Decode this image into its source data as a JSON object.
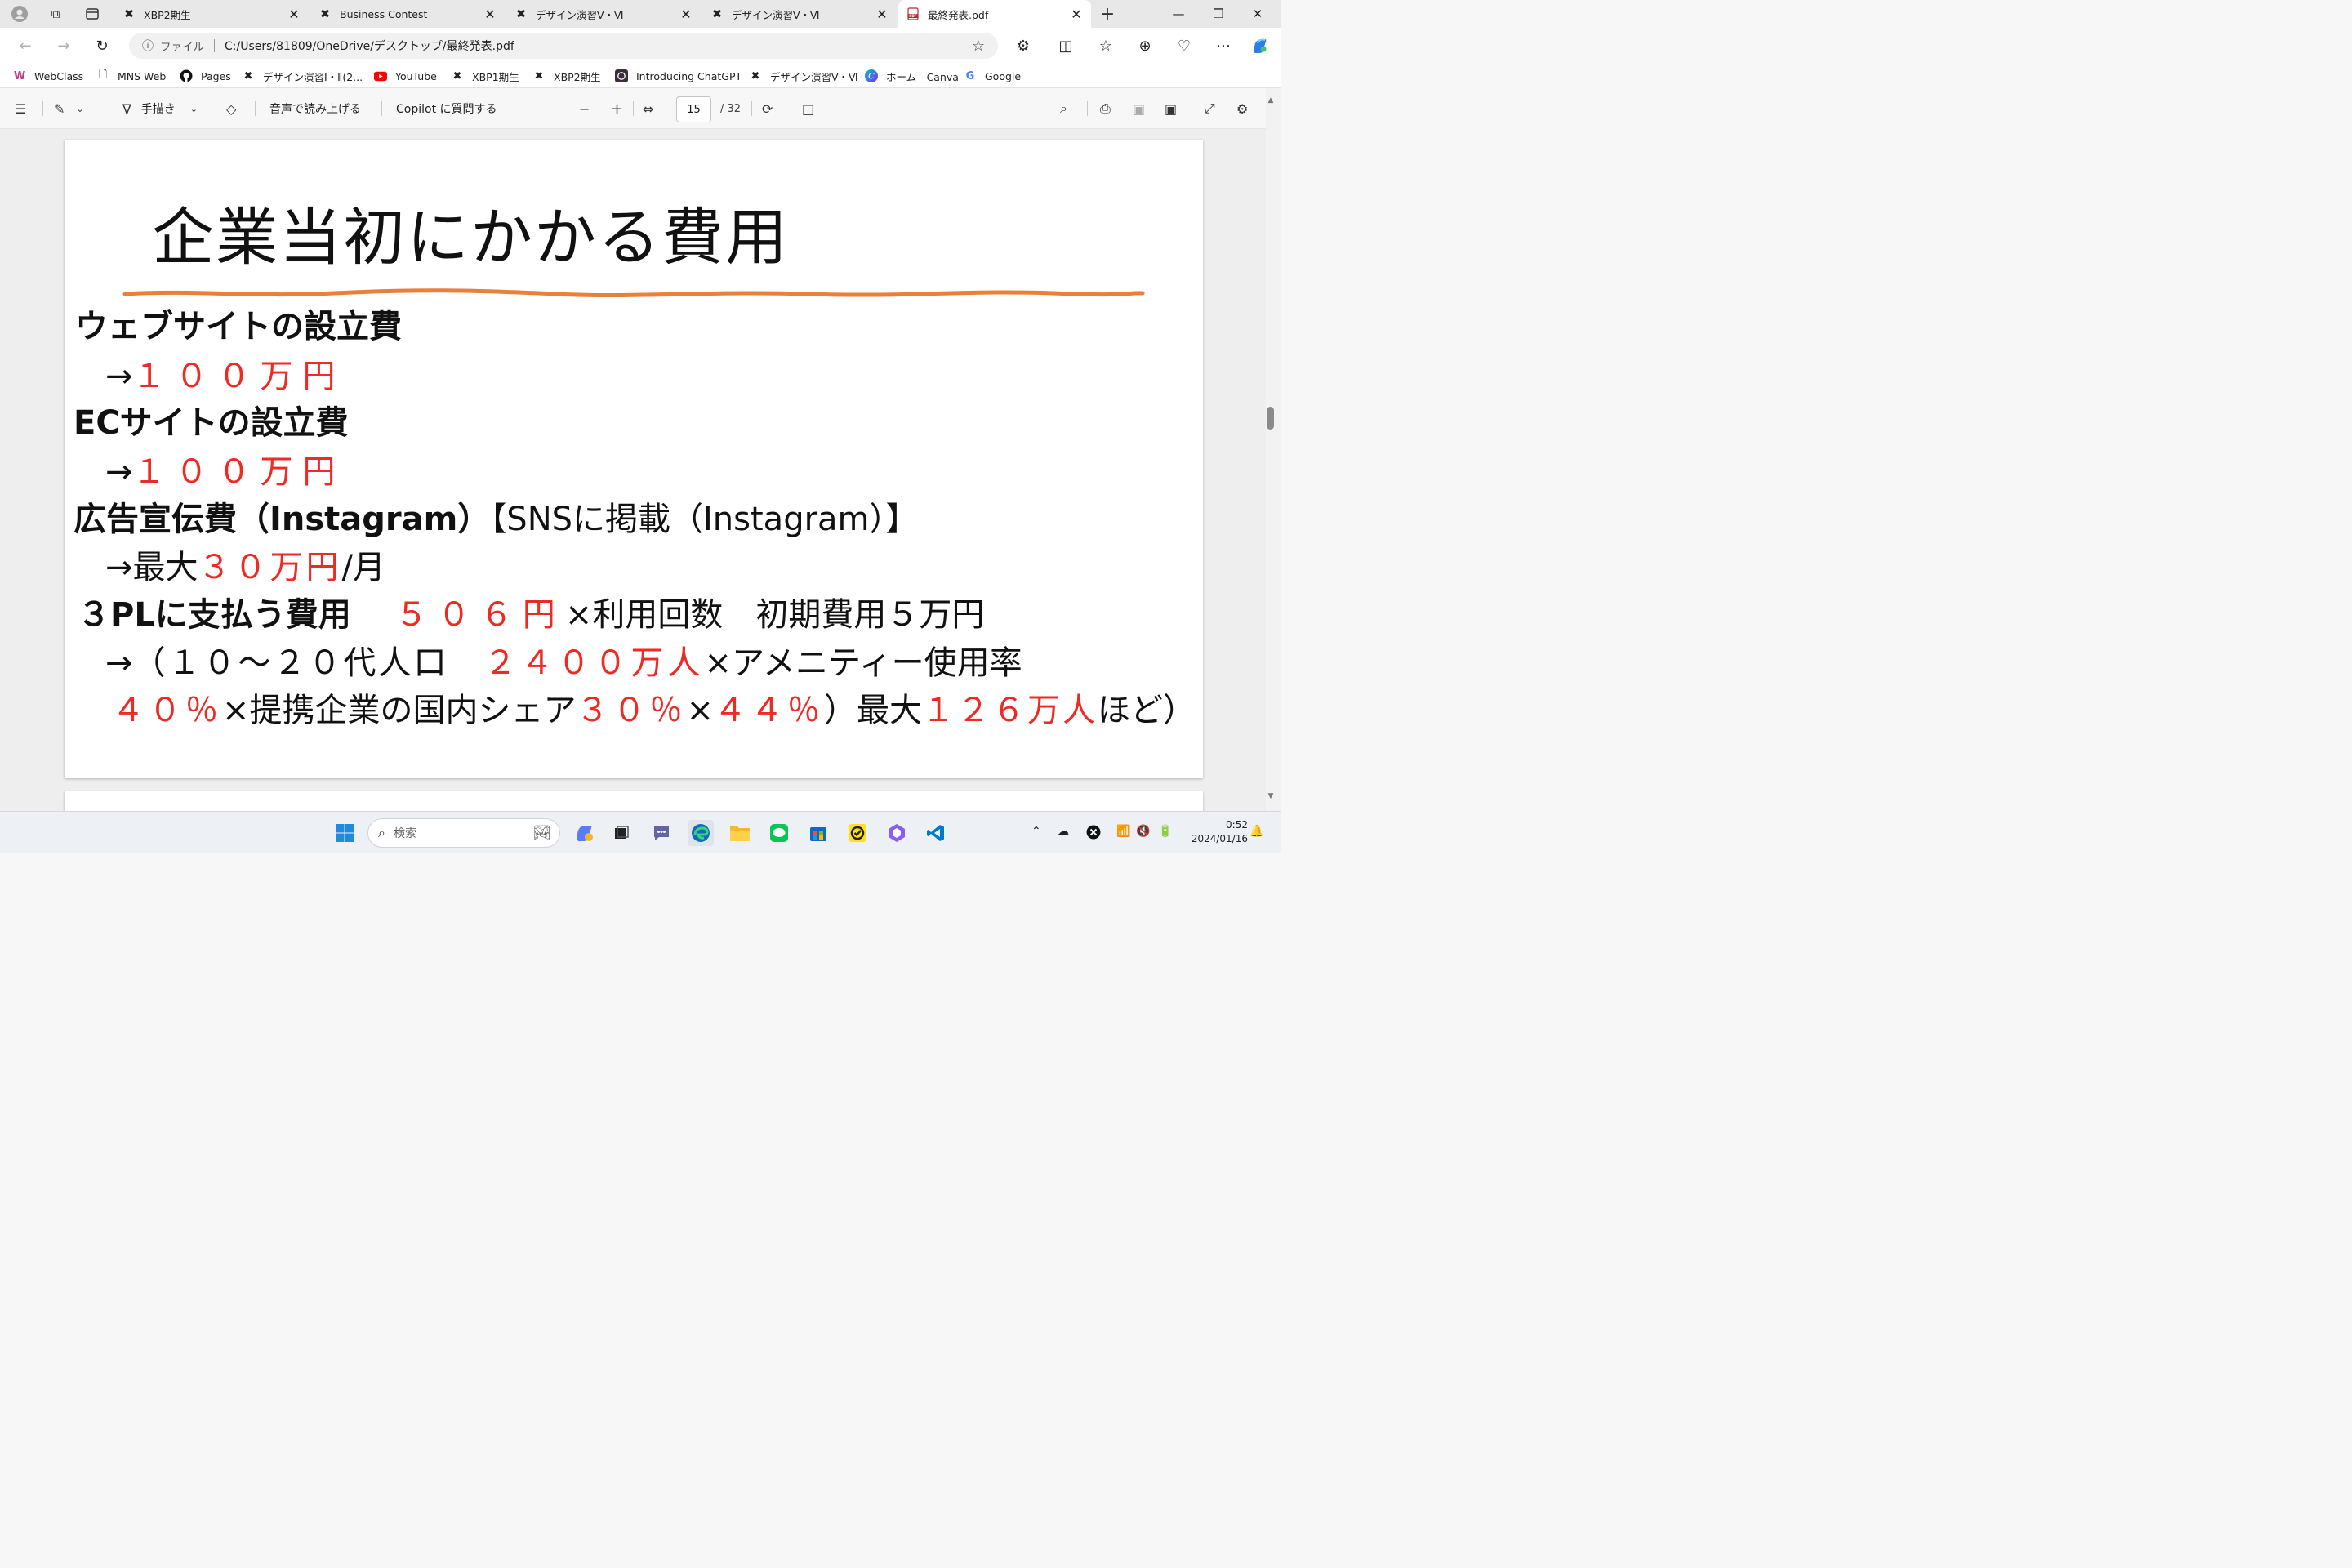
{
  "tabs": [
    {
      "label": "XBP2期生"
    },
    {
      "label": "Business Contest"
    },
    {
      "label": "デザイン演習Ⅴ・Ⅵ"
    },
    {
      "label": "デザイン演習Ⅴ・Ⅵ"
    },
    {
      "label": "最終発表.pdf"
    }
  ],
  "address": {
    "scheme": "ファイル",
    "url": "C:/Users/81809/OneDrive/デスクトップ/最終発表.pdf"
  },
  "favorites": [
    {
      "label": "WebClass"
    },
    {
      "label": "MNS Web"
    },
    {
      "label": "Pages"
    },
    {
      "label": "デザイン演習Ⅰ・Ⅱ(2..."
    },
    {
      "label": "YouTube"
    },
    {
      "label": "XBP1期生"
    },
    {
      "label": "XBP2期生"
    },
    {
      "label": "Introducing ChatGPT"
    },
    {
      "label": "デザイン演習Ⅴ・Ⅵ"
    },
    {
      "label": "ホーム - Canva"
    },
    {
      "label": "Google"
    }
  ],
  "pdf_toolbar": {
    "draw_label": "手描き",
    "read_aloud": "音声で読み上げる",
    "copilot": "Copilot に質問する",
    "page_current": "15",
    "page_total": "/ 32"
  },
  "slide": {
    "title": "企業当初にかかる費用",
    "web_heading": "ウェブサイトの設立費",
    "arrow": "→",
    "web_cost": "１００万円",
    "ec_heading": "ECサイトの設立費",
    "ec_cost": "１００万円",
    "ad_heading": "広告宣伝費（Instagram）",
    "ad_note": "【SNSに掲載（Instagram）】",
    "ad_prefix": "最大",
    "ad_cost": "３０万円",
    "ad_suffix": "/月",
    "pl_heading": "３PLに支払う費用",
    "pl_cost": "５０６円",
    "pl_mid": "×利用回数　初期費用５万円",
    "calc1_prefix": "（１０〜２０代人口　",
    "calc1_red": "２４００万人",
    "calc1_suffix": "×アメニティー使用率",
    "calc2_red1": "４０％",
    "calc2_mid1": "×提携企業の国内シェア",
    "calc2_red2": "３０％",
    "calc2_mid2": "×",
    "calc2_red3": "４４％",
    "calc2_mid3": "）最大",
    "calc2_red4": "１２６万人",
    "calc2_end": "ほど）"
  },
  "taskbar": {
    "search_placeholder": "検索",
    "time": "0:52",
    "date": "2024/01/16"
  },
  "colors": {
    "accent_red": "#ee2a24",
    "underline_orange": "#e8803a",
    "edge_blue": "#0f6cbd"
  }
}
